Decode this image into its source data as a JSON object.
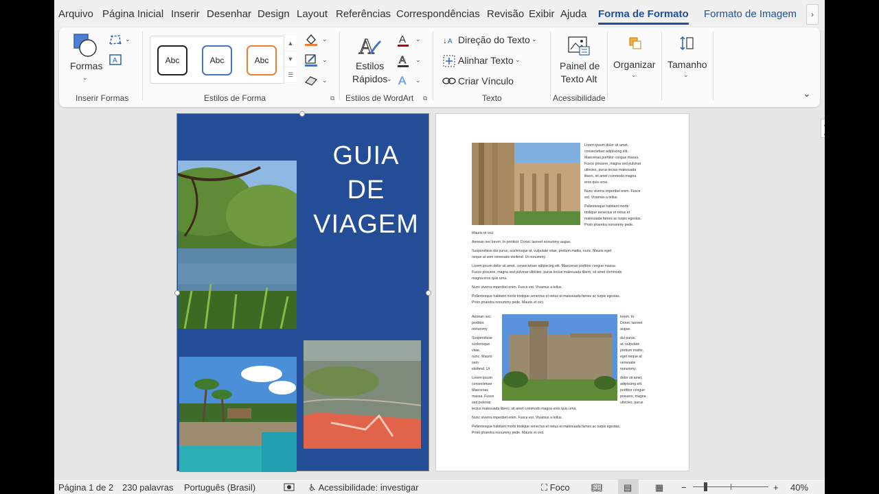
{
  "menu": {
    "tabs": [
      "Arquivo",
      "Página Inicial",
      "Inserir",
      "Desenhar",
      "Design",
      "Layout",
      "Referências",
      "Correspondências",
      "Revisão",
      "Exibir",
      "Ajuda",
      "Forma de Formato",
      "Formato de Imagem"
    ],
    "active_tab": "Forma de Formato",
    "scroll_glyph": "›"
  },
  "ribbon": {
    "insert_shapes": {
      "shapes_label": "Formas",
      "group_label": "Inserir Formas"
    },
    "shape_styles": {
      "samples": [
        "Abc",
        "Abc",
        "Abc"
      ],
      "group_label": "Estilos de Forma"
    },
    "wordart": {
      "quick_styles_label_1": "Estilos",
      "quick_styles_label_2": "Rápidos",
      "group_label": "Estilos de WordArt"
    },
    "text": {
      "direction": "Direção do Texto",
      "align": "Alinhar Texto",
      "link": "Criar Vínculo",
      "group_label": "Texto"
    },
    "accessibility": {
      "alt_text_1": "Painel de",
      "alt_text_2": "Texto Alt",
      "group_label": "Acessibilidade"
    },
    "arrange": {
      "label": "Organizar"
    },
    "size": {
      "label": "Tamanho"
    },
    "colors": {
      "accent": "#1f4e9c",
      "abc1_border": "#222222",
      "abc2_border": "#4472c4",
      "abc3_border": "#ed7d31"
    }
  },
  "document": {
    "cover_title_lines": [
      "GUIA",
      "DE",
      "VIAGEM"
    ],
    "cover_bg": "#244d97",
    "body": {
      "col1": [
        "Lorem ipsum dolor sit amet,",
        "consectetuer adipiscing elit.",
        "Maecenas porttitor congue massa.",
        "Fusce posuere, magna sed pulvinar",
        "ultricies, purus lectus malesuada",
        "libero, sit amet commodo magna",
        "eros quis urna.",
        "",
        "Nunc viverra imperdiet enim. Fusce",
        "est. Vivamus a tellus.",
        "",
        "Pellentesque habitant morbi",
        "tristique senectus et netus et",
        "malesuada fames ac turpis egestas.",
        "Proin pharetra nonummy pede."
      ],
      "full": [
        "Mauris et orci.",
        "",
        "Aenean nec lorem. In porttitor. Donec laoreet nonummy augue.",
        "",
        "Suspendisse dui purus, scelerisque at, vulputate vitae, pretium mattis, nunc. Mauris eget",
        "neque at sem venenatis eleifend. Ut nonummy.",
        "",
        "Lorem ipsum dolor sit amet, consectetuer adipiscing elit. Maecenas porttitor congue massa.",
        "Fusce posuere, magna sed pulvinar ultricies, purus lectus malesuada libero, sit amet commodo",
        "magna eros quis urna.",
        "",
        "Nunc viverra imperdiet enim. Fusce est. Vivamus a tellus.",
        "",
        "Pellentesque habitant morbi tristique senectus et netus et malesuada fames ac turpis egestas.",
        "Proin pharetra nonummy pede. Mauris et orci."
      ],
      "left_wrap": [
        "Aenean nec",
        "porttitor.",
        "nonummy",
        "",
        "Suspendisse",
        "scelerisque",
        "vitae,",
        "nunc. Mauris",
        "sem",
        "eleifend. Ut",
        "",
        "Lorem ipsum",
        "consectetuer",
        "Maecenas",
        "massa. Fusce",
        "sed pulvinar"
      ],
      "right_wrap": [
        "lorem. In",
        "Donec laoreet",
        "augue.",
        "",
        "dui purus,",
        "at, vulputate",
        "pretium mattis,",
        "eget neque at",
        "venenatis",
        "nonummy.",
        "",
        "dolor sit amet,",
        "adipiscing elit.",
        "porttitor congue",
        "posuere, magna",
        "ultricies, purus"
      ],
      "tail": [
        "lectus malesuada libero, sit amet commodo magna eros quis urna.",
        "",
        "Nunc viverra imperdiet enim. Fusce est. Vivamus a tellus.",
        "",
        "Pellentesque habitant morbi tristique senectus et netus et malesuada fames ac turpis egestas.",
        "Proin pharetra nonummy pede. Mauris et orci."
      ]
    }
  },
  "status": {
    "page": "Página 1 de 2",
    "words": "230 palavras",
    "language": "Português (Brasil)",
    "accessibility": "Acessibilidade: investigar",
    "focus": "Foco",
    "zoom_minus": "−",
    "zoom_plus": "+",
    "zoom": "40%"
  }
}
